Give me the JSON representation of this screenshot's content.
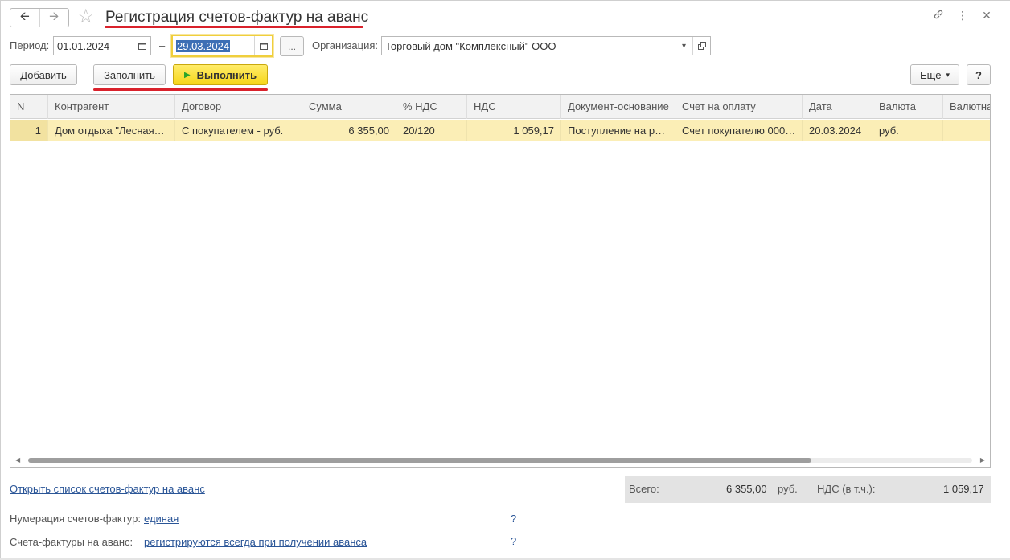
{
  "header": {
    "title": "Регистрация счетов-фактур на аванс",
    "back_icon": "arrow-left-icon",
    "forward_icon": "arrow-right-icon",
    "favorite_icon": "star-icon",
    "link_icon": "link-icon",
    "more_icon": "more-vertical-icon",
    "close_icon": "close-icon"
  },
  "period": {
    "label": "Период:",
    "from": "01.01.2024",
    "dash": "–",
    "to": "29.03.2024",
    "dots_label": "..."
  },
  "organization": {
    "label": "Организация:",
    "value": "Торговый дом \"Комплексный\" ООО"
  },
  "toolbar": {
    "add_label": "Добавить",
    "fill_label": "Заполнить",
    "run_label": "Выполнить",
    "more_label": "Еще",
    "help_label": "?"
  },
  "table": {
    "columns": [
      "N",
      "Контрагент",
      "Договор",
      "Сумма",
      "% НДС",
      "НДС",
      "Документ-основание",
      "Счет на оплату",
      "Дата",
      "Валюта",
      "Валютна"
    ],
    "rows": [
      {
        "n": "1",
        "counterparty": "Дом отдыха \"Лесная…",
        "contract": "С покупателем - руб.",
        "sum": "6 355,00",
        "vat_rate": "20/120",
        "vat": "1 059,17",
        "base_doc": "Поступление на р…",
        "invoice": "Счет покупателю 000…",
        "date": "20.03.2024",
        "currency": "руб.",
        "currency_sum": ""
      }
    ]
  },
  "footer": {
    "open_list_link": "Открыть список счетов-фактур на аванс",
    "numbering_label": "Нумерация счетов-фактур:",
    "numbering_value": "единая",
    "advance_label": "Счета-фактуры на аванс:",
    "advance_value": "регистрируются всегда при получении аванса",
    "help_label": "?"
  },
  "totals": {
    "total_label": "Всего:",
    "total_value": "6 355,00",
    "currency": "руб.",
    "vat_label": "НДС (в т.ч.):",
    "vat_value": "1 059,17"
  },
  "colors": {
    "accent_red": "#d9212b",
    "run_button": "#f6d619",
    "selected_row": "#fbeeb6",
    "link": "#2a5597"
  }
}
